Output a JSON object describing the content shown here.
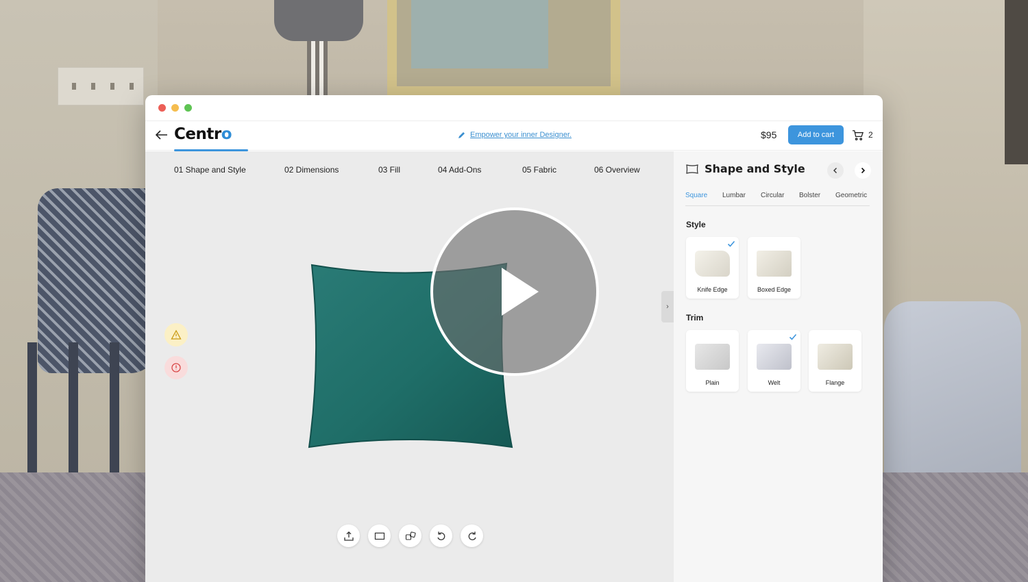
{
  "header": {
    "logo": "Centr",
    "logo_accent": "o",
    "tagline": "Empower your inner Designer.",
    "price": "$95",
    "add_to_cart": "Add to cart",
    "cart_count": "2"
  },
  "steps": [
    {
      "label": "01 Shape and Style",
      "active": true
    },
    {
      "label": "02 Dimensions"
    },
    {
      "label": "03 Fill"
    },
    {
      "label": "04 Add-Ons"
    },
    {
      "label": "05 Fabric"
    },
    {
      "label": "06 Overview"
    }
  ],
  "panel": {
    "title": "Shape and Style",
    "shape_tabs": [
      {
        "label": "Square",
        "active": true
      },
      {
        "label": "Lumbar"
      },
      {
        "label": "Circular"
      },
      {
        "label": "Bolster"
      },
      {
        "label": "Geometric"
      }
    ],
    "style_label": "Style",
    "style_options": [
      {
        "label": "Knife Edge",
        "selected": true
      },
      {
        "label": "Boxed Edge"
      }
    ],
    "trim_label": "Trim",
    "trim_options": [
      {
        "label": "Plain"
      },
      {
        "label": "Welt",
        "selected": true
      },
      {
        "label": "Flange"
      }
    ]
  },
  "colors": {
    "accent": "#3d95dd",
    "pillow": "#1f6e68"
  }
}
